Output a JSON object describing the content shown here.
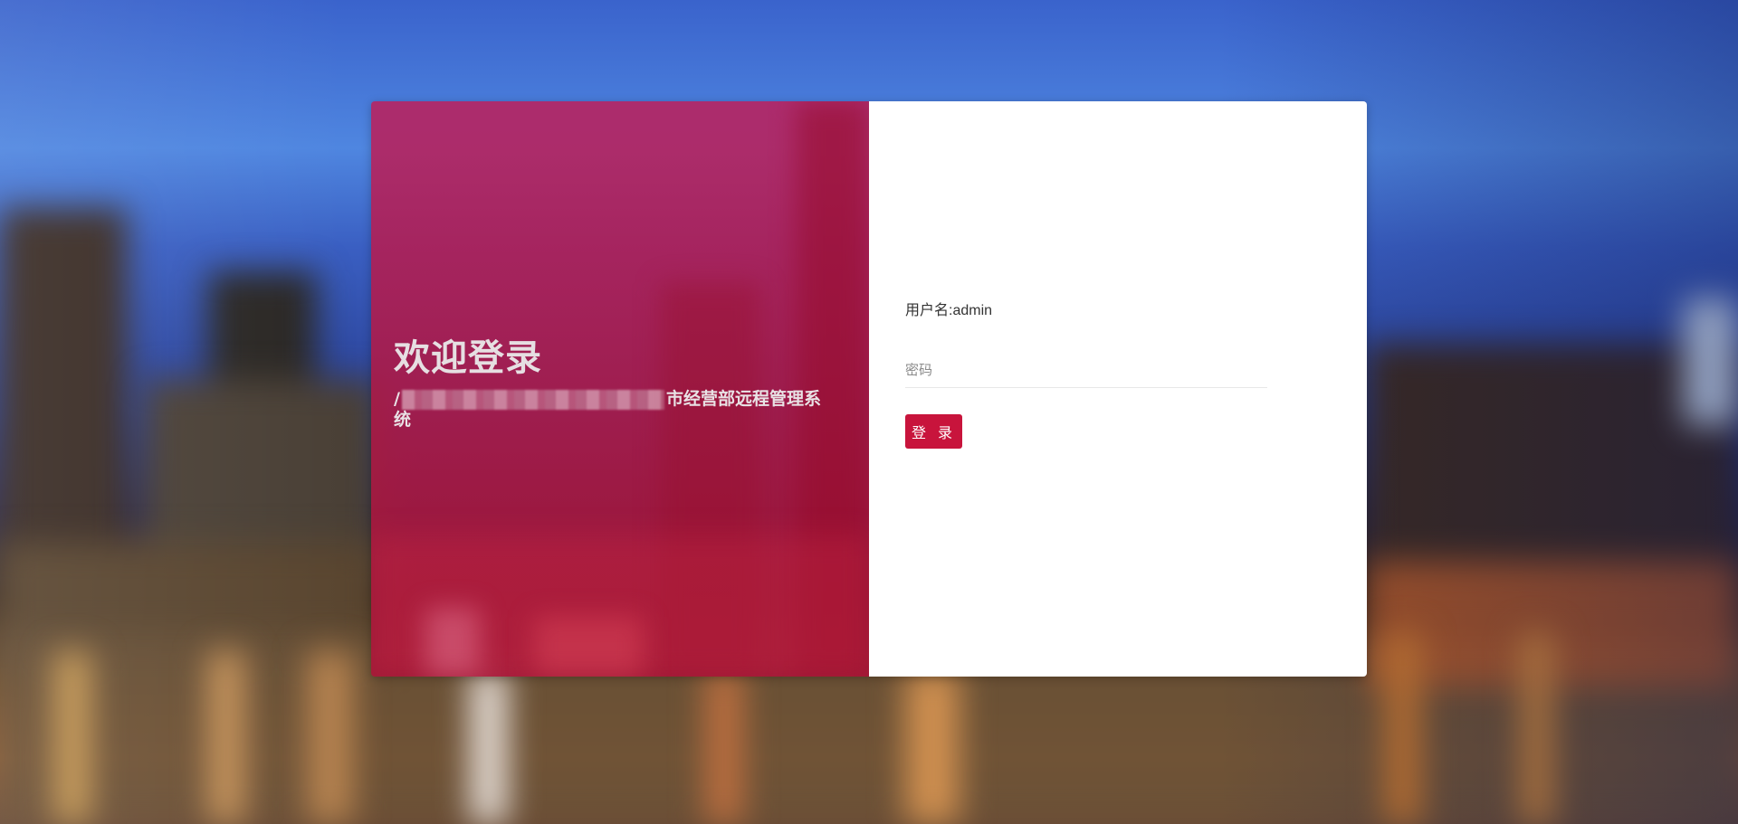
{
  "login": {
    "welcome_title": "欢迎登录",
    "subtitle_prefix": "/",
    "subtitle_suffix": "市经营部远程管理系统",
    "username_label": "用户名:admin",
    "password_placeholder": "密码",
    "login_button": "登 录"
  },
  "colors": {
    "accent": "#c8143c",
    "left_panel": "#b01e4a"
  }
}
